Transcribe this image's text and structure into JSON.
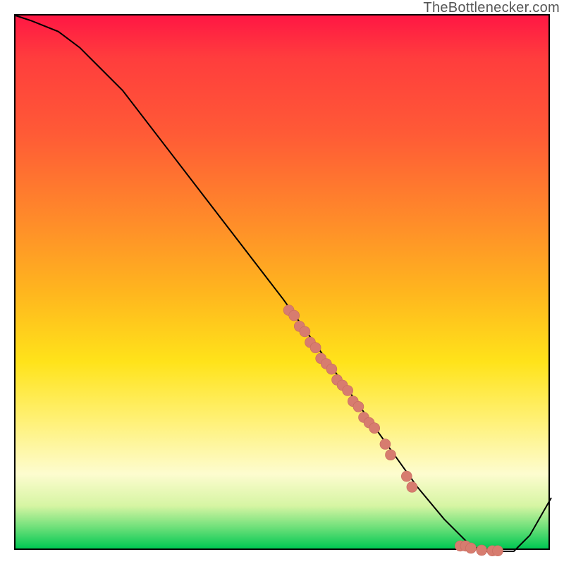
{
  "watermark": "TheBottlenecker.com",
  "chart_data": {
    "type": "line",
    "title": "",
    "xlabel": "",
    "ylabel": "",
    "xlim": [
      0,
      100
    ],
    "ylim": [
      0,
      100
    ],
    "grid": false,
    "series": [
      {
        "name": "curve",
        "x": [
          0,
          3,
          8,
          12,
          16,
          20,
          30,
          40,
          50,
          55,
          60,
          65,
          70,
          75,
          80,
          83,
          85,
          88,
          90,
          93,
          96,
          100
        ],
        "y": [
          100,
          99,
          97,
          94,
          90,
          86,
          73,
          60,
          47,
          40,
          33,
          26,
          19,
          12,
          6,
          3,
          1,
          0,
          0,
          0,
          3,
          10
        ]
      }
    ],
    "points": {
      "name": "scatter_on_curve",
      "x": [
        51,
        52,
        53,
        54,
        55,
        56,
        57,
        58,
        59,
        60,
        61,
        62,
        63,
        64,
        65,
        66,
        67,
        69,
        70,
        73,
        74,
        83,
        84,
        85,
        87,
        89,
        90
      ],
      "y": [
        45,
        44,
        42,
        41,
        39,
        38,
        36,
        35,
        34,
        32,
        31,
        30,
        28,
        27,
        25,
        24,
        23,
        20,
        18,
        14,
        12,
        1,
        1,
        0.6,
        0.2,
        0.1,
        0.1
      ]
    },
    "colors": {
      "dot_fill": "#d77c6f",
      "dot_stroke": "#c56a5e",
      "curve": "#000000"
    }
  }
}
